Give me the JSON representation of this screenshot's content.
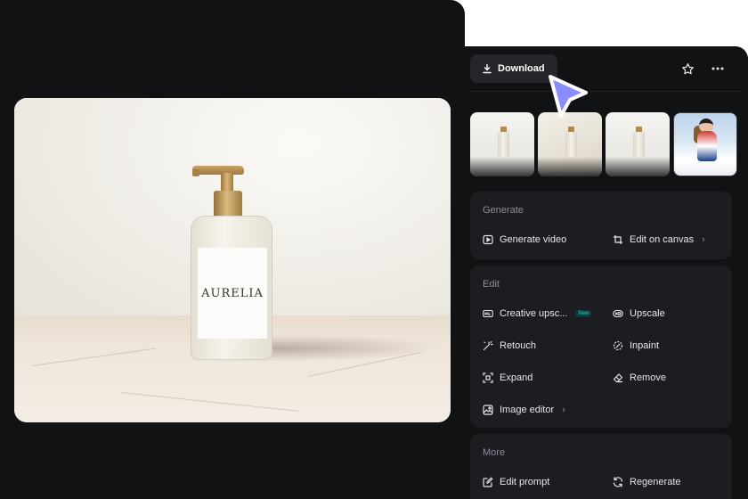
{
  "preview": {
    "product_label": "AURELIA"
  },
  "toolbar": {
    "download_label": "Download",
    "star_icon": "star-icon",
    "more_icon": "more-horizontal-icon"
  },
  "generate": {
    "title": "Generate",
    "items": [
      {
        "label": "Generate video",
        "icon": "play-square-icon"
      },
      {
        "label": "Edit on canvas",
        "icon": "crop-frame-icon"
      }
    ]
  },
  "edit": {
    "title": "Edit",
    "items": [
      {
        "label": "Creative upsc...",
        "icon": "hd-plus-icon",
        "badge": "New"
      },
      {
        "label": "Upscale",
        "icon": "hd-icon"
      },
      {
        "label": "Retouch",
        "icon": "magic-wand-icon"
      },
      {
        "label": "Inpaint",
        "icon": "inpaint-icon"
      },
      {
        "label": "Expand",
        "icon": "expand-icon"
      },
      {
        "label": "Remove",
        "icon": "eraser-icon"
      },
      {
        "label": "Image editor",
        "icon": "image-edit-icon"
      }
    ]
  },
  "more": {
    "title": "More",
    "items": [
      {
        "label": "Edit prompt",
        "icon": "edit-prompt-icon"
      },
      {
        "label": "Regenerate",
        "icon": "refresh-icon"
      }
    ]
  },
  "colors": {
    "panel_bg": "#111214",
    "card_bg": "#1c1d21",
    "button_bg": "#24262b",
    "cursor": "#8a8cff",
    "badge": "#29d0b0"
  }
}
